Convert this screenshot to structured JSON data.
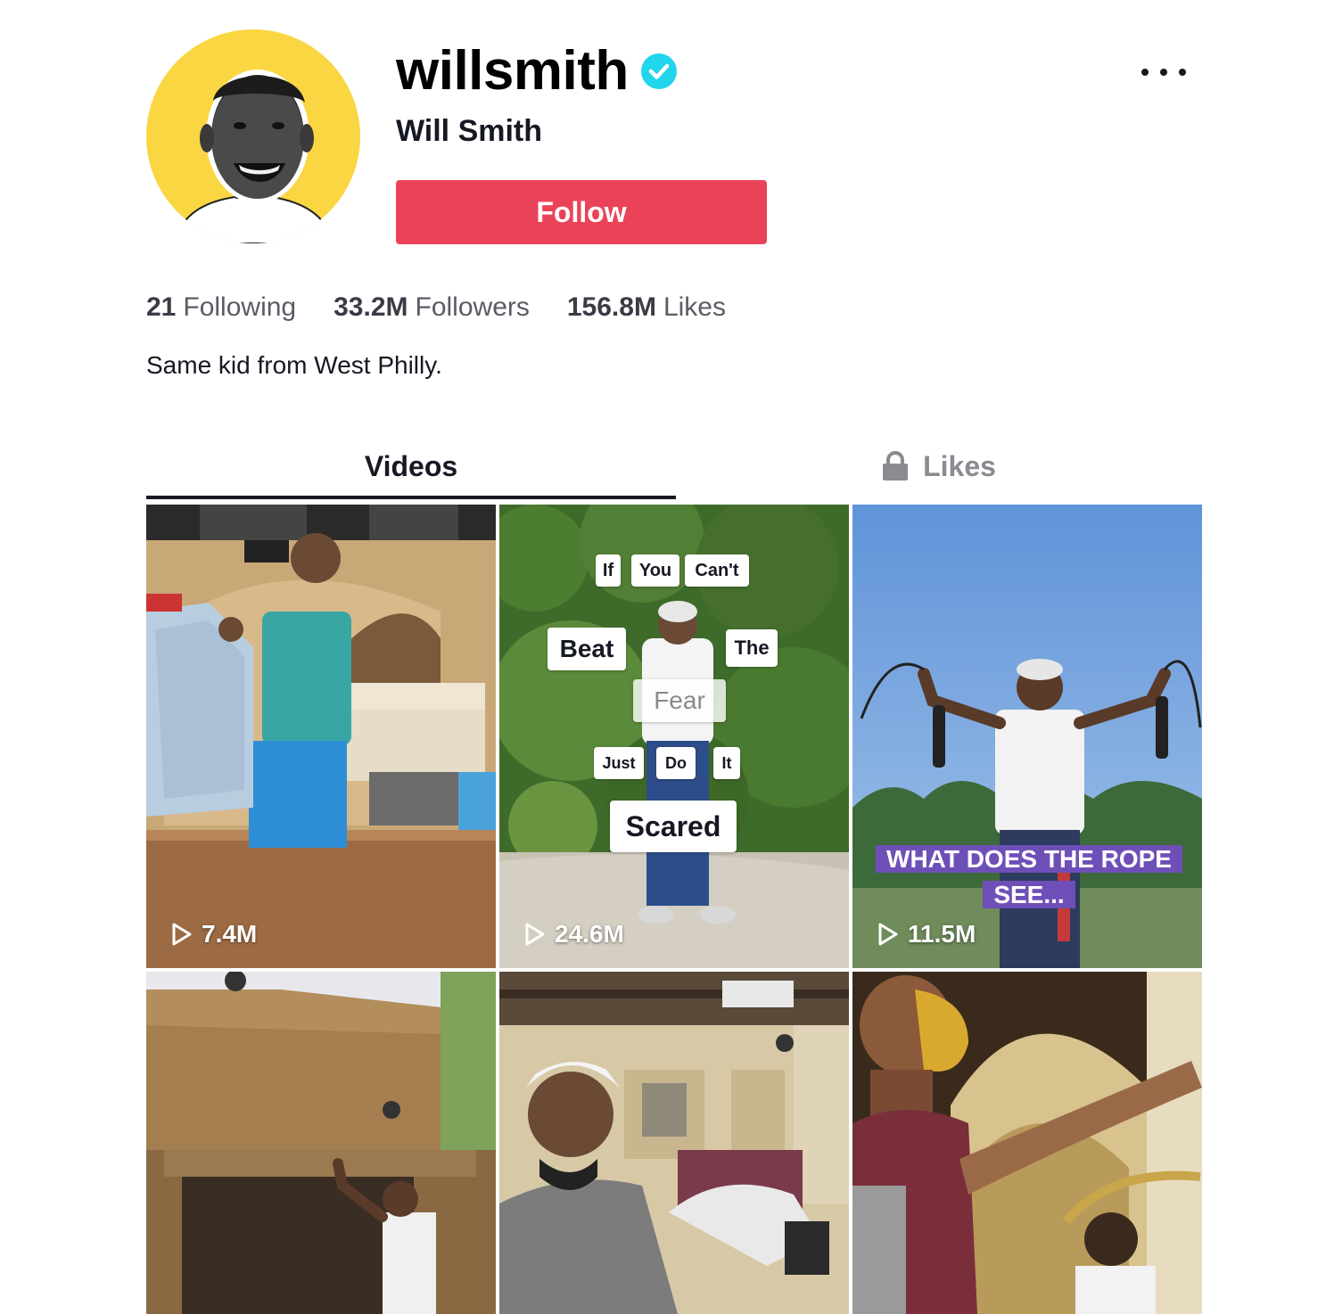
{
  "profile": {
    "username": "willsmith",
    "display_name": "Will Smith",
    "verified_icon": "verified-check-icon",
    "follow_label": "Follow",
    "more_icon": "more-dots-icon",
    "bio": "Same kid from West Philly."
  },
  "stats": [
    {
      "value": "21",
      "label": "Following"
    },
    {
      "value": "33.2M",
      "label": "Followers"
    },
    {
      "value": "156.8M",
      "label": "Likes"
    }
  ],
  "tabs": [
    {
      "label": "Videos",
      "active": true
    },
    {
      "label": "Likes",
      "icon": "lock-icon",
      "active": false
    }
  ],
  "videos": [
    {
      "views": "7.4M"
    },
    {
      "views": "24.6M",
      "captions": [
        "If",
        "You",
        "Can't",
        "Beat",
        "The",
        "Fear",
        "Just",
        "Do",
        "It",
        "Scared"
      ]
    },
    {
      "views": "11.5M",
      "caption": "WHAT DOES THE ROPE SEE..."
    },
    {},
    {},
    {}
  ],
  "colors": {
    "accent": "#ea4359",
    "verified": "#20d5ec",
    "avatar_bg": "#fad643",
    "text": "#161823",
    "muted": "#8a8b91"
  }
}
